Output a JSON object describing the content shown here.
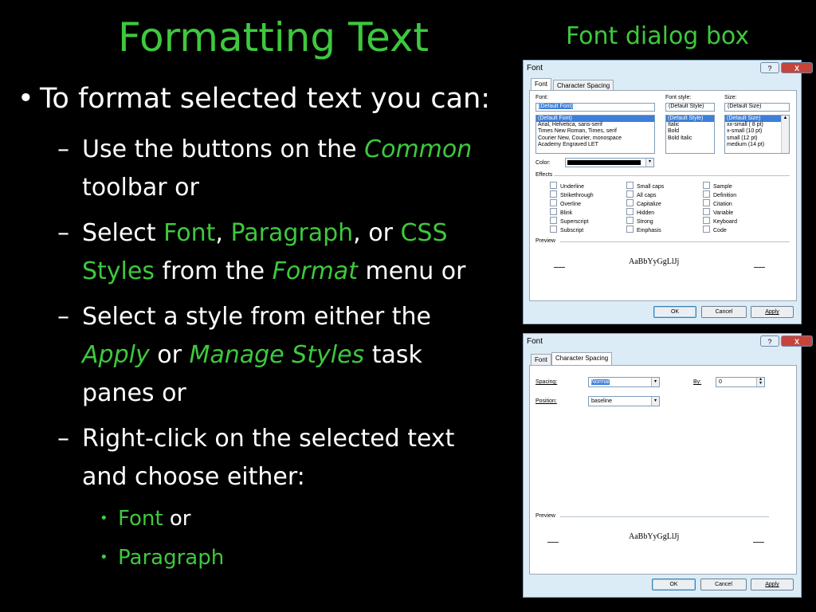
{
  "slide": {
    "title": "Formatting Text",
    "subtitle": "Font dialog box",
    "bullet_main": "To format selected text you can:",
    "b1": {
      "a": "Use the buttons on the ",
      "b": "Common",
      "c": "toolbar or"
    },
    "b2": {
      "a": "Select ",
      "b": "Font",
      "c": ", ",
      "d": "Paragraph",
      "e": ", or ",
      "f": "CSS",
      "g": "Styles",
      "h": " from the ",
      "i": "Format",
      "j": " menu or"
    },
    "b3": {
      "a": "Select a style from either the",
      "b": "Apply",
      "c": " or ",
      "d": "Manage Styles",
      "e": " task",
      "f": "panes or"
    },
    "b4": {
      "a": "Right-click on the selected text",
      "b": "and choose either:"
    },
    "sub1": {
      "a": "Font",
      "b": " or"
    },
    "sub2": "Paragraph",
    "dash": "–",
    "dot": "•"
  },
  "dialog1": {
    "caption": "Font",
    "help": "?",
    "close": "X",
    "tabs": [
      "Font",
      "Character Spacing"
    ],
    "font_label": "Font:",
    "font_value": "(Default Font)",
    "font_list": [
      "(Default Font)",
      "Arial, Helvetica, sans-serif",
      "Times New Roman, Times, serif",
      "Courier New, Courier, monospace",
      "Academy Engraved LET"
    ],
    "style_label": "Font style:",
    "style_value": "(Default Style)",
    "style_list": [
      "(Default Style)",
      "Italic",
      "Bold",
      "Bold Italic"
    ],
    "size_label": "Size:",
    "size_value": "(Default Size)",
    "size_list": [
      "(Default Size)",
      "xx-small  ( 8 pt)",
      "x-small   (10 pt)",
      "small     (12 pt)",
      "medium   (14 pt)"
    ],
    "color_label": "Color:",
    "effects_label": "Effects",
    "effects_col1": [
      "Underline",
      "Strikethrough",
      "Overline",
      "Blink",
      "Superscript",
      "Subscript"
    ],
    "effects_col2": [
      "Small caps",
      "All caps",
      "Capitalize",
      "Hidden",
      "Strong",
      "Emphasis"
    ],
    "effects_col3": [
      "Sample",
      "Definition",
      "Citation",
      "Variable",
      "Keyboard",
      "Code"
    ],
    "preview_label": "Preview",
    "preview_text": "AaBbYyGgLlJj",
    "ok": "OK",
    "cancel": "Cancel",
    "apply": "Apply"
  },
  "dialog2": {
    "caption": "Font",
    "help": "?",
    "close": "X",
    "tabs": [
      "Font",
      "Character Spacing"
    ],
    "spacing_label": "Spacing:",
    "spacing_value": "Normal",
    "by_label": "By:",
    "by_value": "0",
    "position_label": "Position:",
    "position_value": "baseline",
    "preview_label": "Preview",
    "preview_text": "AaBbYyGgLlJj",
    "ok": "OK",
    "cancel": "Cancel",
    "apply": "Apply"
  },
  "colors": {
    "accent": "#3ec83e",
    "background": "#000000",
    "dialog": "#dcecf7"
  }
}
